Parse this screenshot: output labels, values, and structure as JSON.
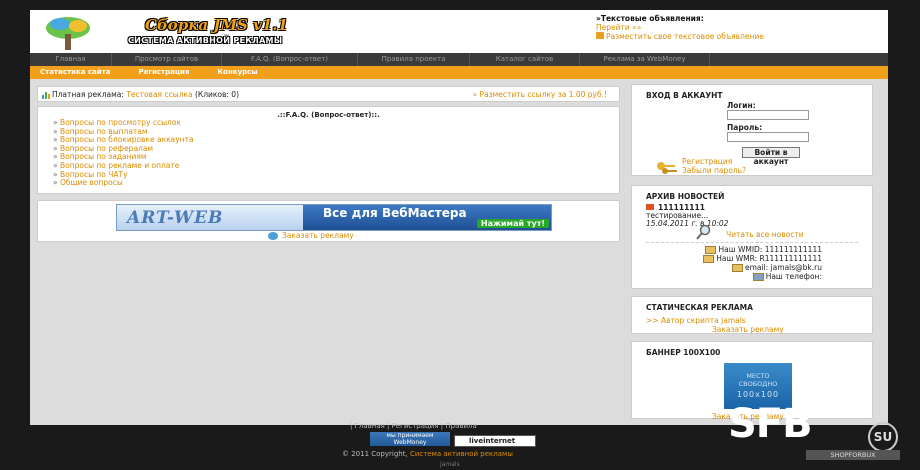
{
  "header": {
    "brand": "Сборка JMS v1.1",
    "subtitle": "СИСТЕМА АКТИВНОЙ РЕКЛАМЫ",
    "text_ads_title": "»Текстовые объявления:",
    "text_ads_goto": "Перейти »»",
    "text_ads_place": "Разместить свое текстовое объявление"
  },
  "nav_main": [
    {
      "label": "Главная",
      "w": 82
    },
    {
      "label": "Просмотр сайтов",
      "w": 110
    },
    {
      "label": "F.A.Q. (Вопрос-ответ)",
      "w": 136
    },
    {
      "label": "Правила проекта",
      "w": 112
    },
    {
      "label": "Каталог сайтов",
      "w": 110
    },
    {
      "label": "Реклама за WebMoney",
      "w": 130
    }
  ],
  "nav_sub": [
    "Статистика сайта",
    "Регистрация",
    "Конкурсы"
  ],
  "paid": {
    "label": "Платная реклама:",
    "value": "Тестовая ссылка",
    "clicks": "(Кликов: 0)",
    "place": "» Разместить ссылку за 1.00 руб.!"
  },
  "faq": {
    "title": ".::F.A.Q. (Вопрос-ответ)::.",
    "items": [
      "Вопросы по просмотру ссылок",
      "Вопросы по выплатам",
      "Вопросы по блокировке аккаунта",
      "Вопросы по рефералам",
      "Вопросы по заданиям",
      "Вопросы по рекламе и оплате",
      "Вопросы по ЧАТу",
      "Общие вопросы"
    ]
  },
  "banner": {
    "left": "ART-WEB",
    "right": "Все для ВебМастера",
    "button": "Нажимай тут!",
    "order": "Заказать рекламу"
  },
  "login": {
    "title": "ВХОД В АККАУНТ",
    "login_label": "Логин:",
    "password_label": "Пароль:",
    "button": "Войти в аккаунт",
    "register": "Регистрация",
    "forgot": "Забыли пароль?"
  },
  "news": {
    "title": "АРХИВ НОВОСТЕЙ",
    "item_title": "111111111",
    "item_text": "тестирование...",
    "item_date": "15.04.2011 г. в 10:02",
    "read_all": "Читать все новости",
    "wmid": "Наш WMID: 111111111111",
    "wmr": "Наш WMR: R111111111111",
    "email": "email: jamals@bk.ru",
    "phone": "Наш телефон:"
  },
  "static_ads": {
    "title": "СТАТИЧЕСКАЯ РЕКЛАМА",
    "author": ">> Автор скрипта jamals",
    "order": "Заказать рекламу"
  },
  "banner100": {
    "title": "БАННЕР 100X100",
    "free1": "МЕСТО",
    "free2": "СВОБОДНО",
    "size": "100x100",
    "order": "Заказать рекламу"
  },
  "footer": {
    "links": "|  Главная  |  Регистрация  |  Правила",
    "webmoney1": "мы принимаем",
    "webmoney2": "WebMoney",
    "liveinternet": "liveinternet",
    "copyright": "© 2011 Copyright,",
    "copyright_link": "Система активной рекламы",
    "bottom": "jamals"
  },
  "watermark": {
    "logo": "SFB",
    "su": "SU",
    "site": "SHOPFORBUX"
  },
  "colors": {
    "accent": "#f2a019",
    "link": "#d98c00",
    "nav_dark": "#3a3a3a"
  }
}
